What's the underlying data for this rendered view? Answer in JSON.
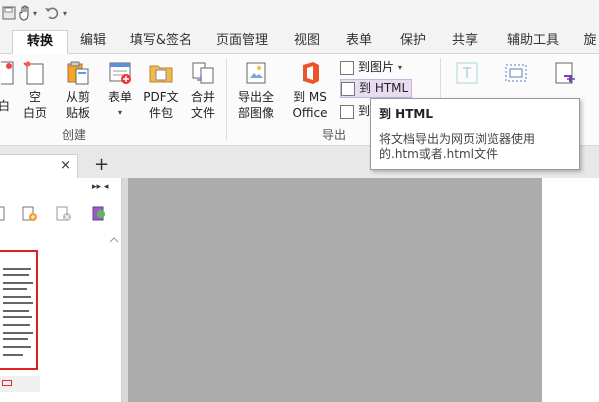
{
  "qat": {
    "caret1": "▾",
    "caret2": "▾"
  },
  "tabs": [
    {
      "label": "转换",
      "active": true
    },
    {
      "label": "编辑"
    },
    {
      "label": "填写&签名"
    },
    {
      "label": "页面管理"
    },
    {
      "label": "视图"
    },
    {
      "label": "表单"
    },
    {
      "label": "保护"
    },
    {
      "label": "共享"
    },
    {
      "label": "辅助工具"
    },
    {
      "label": "旋"
    }
  ],
  "ribbon": {
    "partial_left": "白",
    "blank_page": "空\n白页",
    "from_clipboard": "从剪\n贴板",
    "form": "表单",
    "pdf_package": "PDF文\n件包",
    "combine": "合并\n文件",
    "group_create": "创建",
    "export_all_images": "导出全\n部图像",
    "to_ms_office": "到 MS\nOffice",
    "to_image": "到图片",
    "to_html": "到 HTML",
    "to_other": "到",
    "group_export": "导出",
    "ocr_partial": "OCR",
    "screenshot_partial": "截图"
  },
  "tooltip": {
    "title": "到 HTML",
    "body": "将文档导出为网页浏览器使用的.htm或者.html文件"
  },
  "docbar": {
    "close": "×",
    "add": "+"
  },
  "leftpanel": {
    "header_arrows": "▸▸ ◂"
  },
  "colors": {
    "accent": "#c9b5dc",
    "highlight": "#e7dcf0",
    "thumb_border": "#dd2222"
  }
}
